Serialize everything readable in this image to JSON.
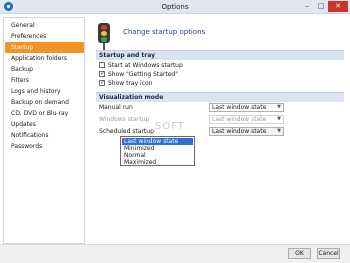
{
  "window": {
    "title": "Options",
    "minimize": "–",
    "maximize": "□",
    "close": "✕"
  },
  "sidebar": {
    "items": [
      {
        "label": "General"
      },
      {
        "label": "Preferences"
      },
      {
        "label": "Startup",
        "active": true
      },
      {
        "label": "Application folders"
      },
      {
        "label": "Backup"
      },
      {
        "label": "Filters"
      },
      {
        "label": "Logs and history"
      },
      {
        "label": "Backup on demand"
      },
      {
        "label": "CD, DVD or Blu-ray"
      },
      {
        "label": "Updates"
      },
      {
        "label": "Notifications"
      },
      {
        "label": "Passwords"
      }
    ]
  },
  "page": {
    "heading": "Change startup options",
    "icon": "traffic-light-icon"
  },
  "startup_tray": {
    "heading": "Startup and tray",
    "options": [
      {
        "label": "Start at Windows startup",
        "checked": false
      },
      {
        "label": "Show \"Getting Started\"",
        "checked": true
      },
      {
        "label": "Show tray icon",
        "checked": true
      }
    ]
  },
  "visualization": {
    "heading": "Visualization mode",
    "fields": [
      {
        "label": "Manual run",
        "value": "Last window state",
        "enabled": true
      },
      {
        "label": "Windows startup",
        "value": "Last window state",
        "enabled": false
      },
      {
        "label": "Scheduled startup",
        "value": "Last window state",
        "enabled": true,
        "open": true
      }
    ],
    "dropdown_options": [
      "Last window state",
      "Minimized",
      "Normal",
      "Maximized"
    ],
    "highlighted_option": "Last window state"
  },
  "watermark": "SOFT",
  "footer": {
    "ok_label": "OK",
    "cancel_label": "Cancel"
  },
  "colors": {
    "accent": "#f39325",
    "highlight": "#2f6fd0",
    "group_header": "#dbe3ee"
  }
}
